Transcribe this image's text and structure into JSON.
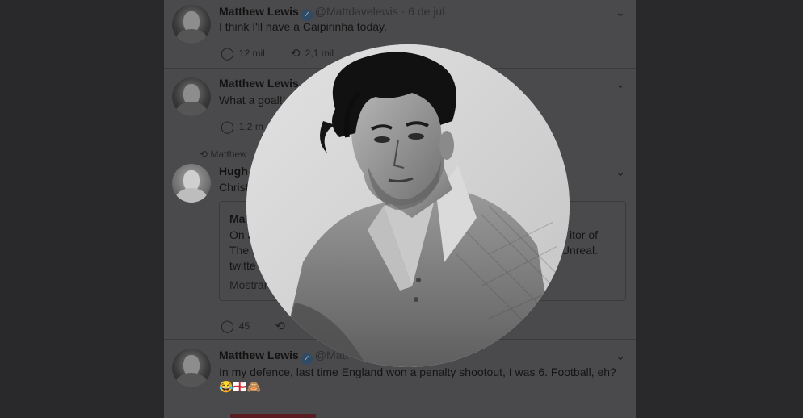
{
  "tweets": [
    {
      "name": "Matthew Lewis",
      "handle": "@Mattdavelewis",
      "separator": "·",
      "date": "6 de jul",
      "text": "I think I'll have a Caipirinha today.",
      "replies": "12 mil",
      "retweets": "2,1 mil"
    },
    {
      "name": "Matthew Lewis",
      "text": "What a goal!!",
      "replies": "1,2 m"
    },
    {
      "retweeted_by": "Matthew",
      "name": "Hugh",
      "text": "Christ",
      "quote": {
        "name": "Ma",
        "line1_start": "On a",
        "line1_end": "itor of",
        "line2_start": "The S",
        "line2_end": "Unreal.",
        "line3": "twitte",
        "show_more": "Mostrar"
      },
      "replies": "45"
    },
    {
      "name": "Matthew Lewis",
      "handle": "@Matt",
      "text": "In my defence, last time England won a penalty shootout, I was 6. Football, eh?",
      "emoji": "😂🏴󠁧󠁢󠁥󠁮󠁧󠁿🙈"
    }
  ],
  "icons": {
    "reply": "reply-icon",
    "retweet": "retweet-icon",
    "verified": "verified-badge-icon",
    "chevron": "chevron-down-icon"
  },
  "colors": {
    "backdrop": "#29292b",
    "feed": "#4a4a4c"
  }
}
